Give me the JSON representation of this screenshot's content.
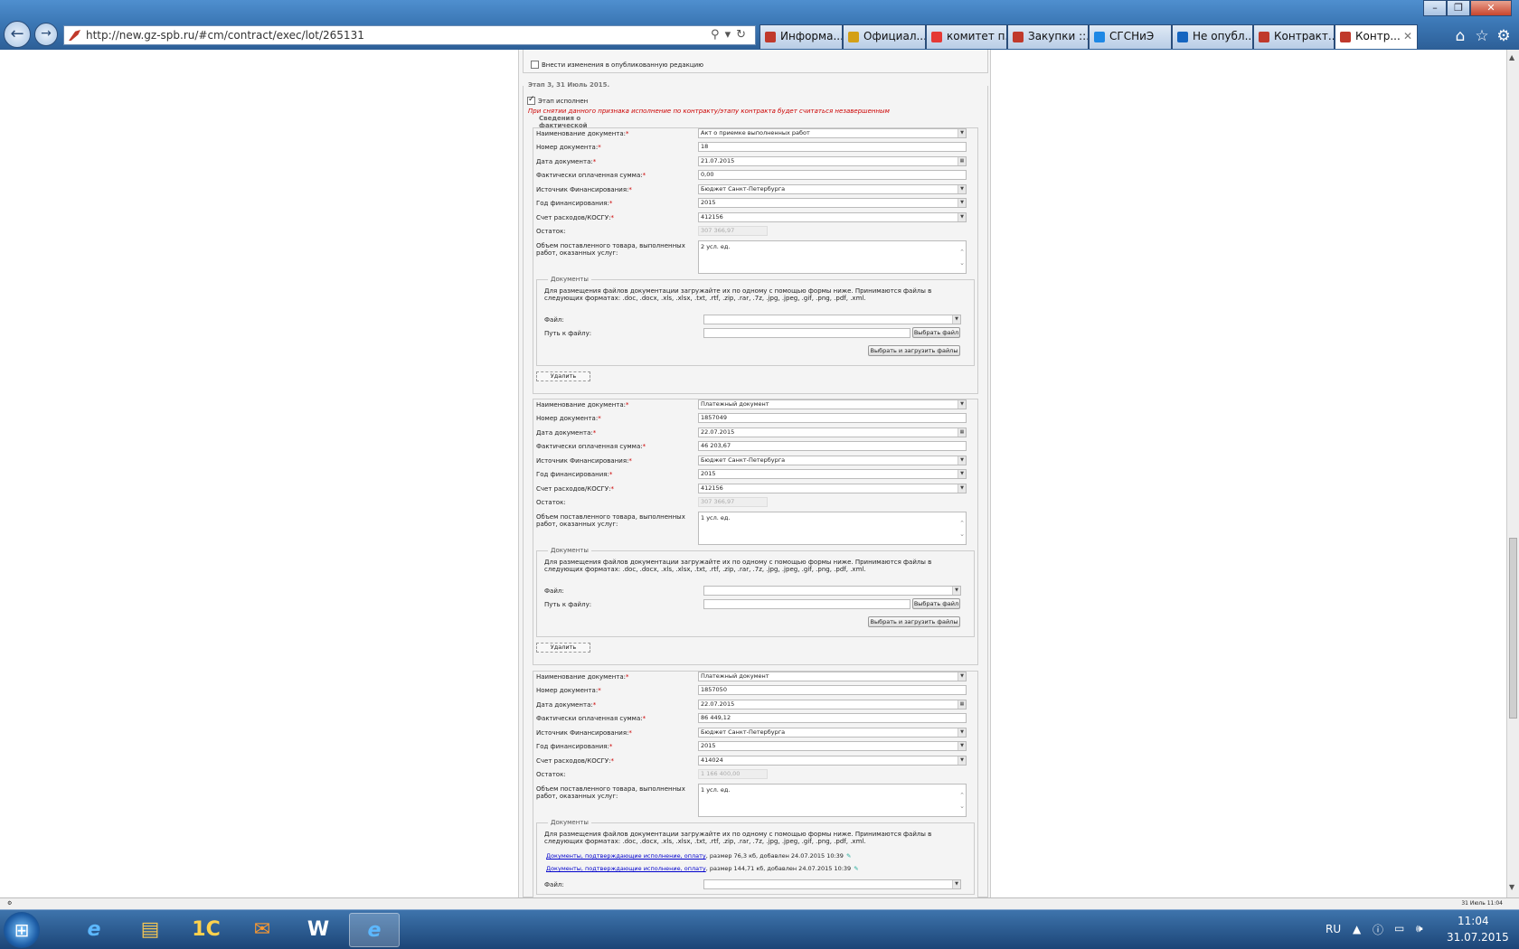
{
  "browser": {
    "url": "http://new.gz-spb.ru/#cm/contract/exec/lot/265131",
    "tabs": [
      {
        "label": "Информа...",
        "color": "#c0392b"
      },
      {
        "label": "Официал...",
        "color": "#d4a017"
      },
      {
        "label": "комитет п...",
        "color": "#e53935"
      },
      {
        "label": "Закупки ::...",
        "color": "#c0392b"
      },
      {
        "label": "СГСНиЭ",
        "color": "#1e88e5"
      },
      {
        "label": "Не опубл...",
        "color": "#1565c0"
      },
      {
        "label": "Контракт...",
        "color": "#c0392b"
      },
      {
        "label": "Контр...",
        "color": "#c0392b"
      }
    ]
  },
  "form": {
    "publish_changes_label": "Внести изменения в опубликованную редакцию",
    "stage_title": "Этап 3, 31 Июль 2015.",
    "stage_done_label": "Этап исполнен",
    "warning": "При снятии данного признака исполнение по контракту/этапу контракта будет считаться незавершенным",
    "facts_label": "Сведения о фактической",
    "labels": {
      "doc_name": "Наименование документа:",
      "doc_number": "Номер документа:",
      "doc_date": "Дата документа:",
      "paid_sum": "Фактически оплаченная сумма:",
      "fin_source": "Источник Финансирования:",
      "fin_year": "Год финансирования:",
      "account": "Счет расходов/КОСГУ:",
      "remainder": "Остаток:",
      "volume": "Объем поставленного товара, выполненных работ, оказанных услуг:",
      "req": "*"
    },
    "docs": {
      "legend": "Документы",
      "info": "Для размещения файлов документации загружайте их по одному с помощью формы ниже. Принимаются файлы в следующих форматах: .doc, .docx, .xls, .xlsx, .txt, .rtf, .zip, .rar, .7z, .jpg, .jpeg, .gif, .png, .pdf, .xml.",
      "file_label": "Файл:",
      "path_label": "Путь к файлу:",
      "choose_file": "Выбрать файл",
      "choose_upload": "Выбрать и загрузить файлы"
    },
    "delete_label": "Удалить",
    "records": [
      {
        "doc_name": "Акт о приемке выполненных работ",
        "doc_number": "18",
        "doc_date": "21.07.2015",
        "paid_sum": "0,00",
        "fin_source": "Бюджет Санкт-Петербурга",
        "fin_year": "2015",
        "account": "412156",
        "remainder": "307 366,97",
        "volume": "2 усл. ед."
      },
      {
        "doc_name": "Платежный документ",
        "doc_number": "1857049",
        "doc_date": "22.07.2015",
        "paid_sum": "46 203,67",
        "fin_source": "Бюджет Санкт-Петербурга",
        "fin_year": "2015",
        "account": "412156",
        "remainder": "307 366,97",
        "volume": "1 усл. ед."
      },
      {
        "doc_name": "Платежный документ",
        "doc_number": "1857050",
        "doc_date": "22.07.2015",
        "paid_sum": "86 449,12",
        "fin_source": "Бюджет Санкт-Петербурга",
        "fin_year": "2015",
        "account": "414024",
        "remainder": "1 166 400,00",
        "volume": "1 усл. ед."
      }
    ],
    "attachments": [
      {
        "link": "Документы, подтверждающие исполнение, оплату",
        "meta": ", размер 76,3 кб, добавлен 24.07.2015 10:39"
      },
      {
        "link": "Документы, подтверждающие исполнение, оплату",
        "meta": ", размер 144,71 кб, добавлен 24.07.2015 10:39"
      }
    ]
  },
  "status_bar": {
    "right": "31 Июль 11:04"
  },
  "taskbar": {
    "lang": "RU",
    "time": "11:04",
    "date": "31.07.2015",
    "apps": [
      "ie",
      "explorer",
      "1c",
      "outlook",
      "word",
      "ie-active"
    ]
  }
}
